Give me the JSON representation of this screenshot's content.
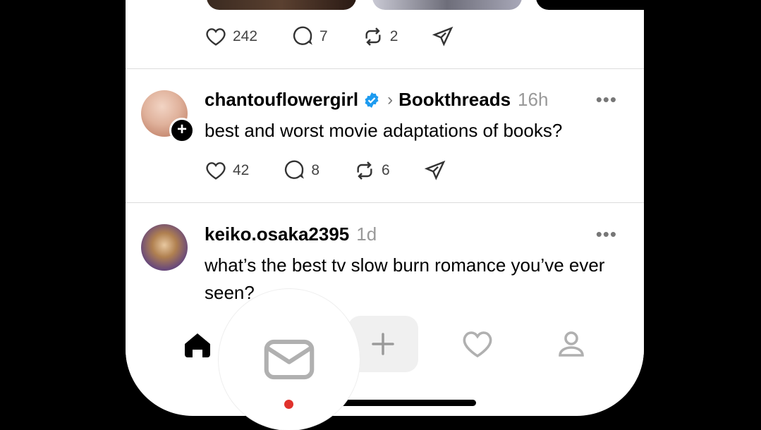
{
  "prev_post": {
    "likes": "242",
    "replies": "7",
    "reposts": "2"
  },
  "posts": [
    {
      "username": "chantouflowergirl",
      "verified": true,
      "community": "Bookthreads",
      "time": "16h",
      "text": "best and worst movie adaptations of books?",
      "likes": "42",
      "replies": "8",
      "reposts": "6"
    },
    {
      "username": "keiko.osaka2395",
      "time": "1d",
      "text": "what’s the best tv slow burn romance you’ve ever seen?"
    }
  ],
  "more_label": "•••",
  "chevron": "›",
  "follow_label": "+",
  "nav": {
    "items": [
      "home-icon",
      "mail-icon",
      "plus-icon",
      "heart-icon",
      "profile-icon"
    ],
    "active": "home"
  },
  "colors": {
    "verified": "#1d9bf0",
    "notification_dot": "#e0322c",
    "icon_gray": "#b0b0b0"
  }
}
